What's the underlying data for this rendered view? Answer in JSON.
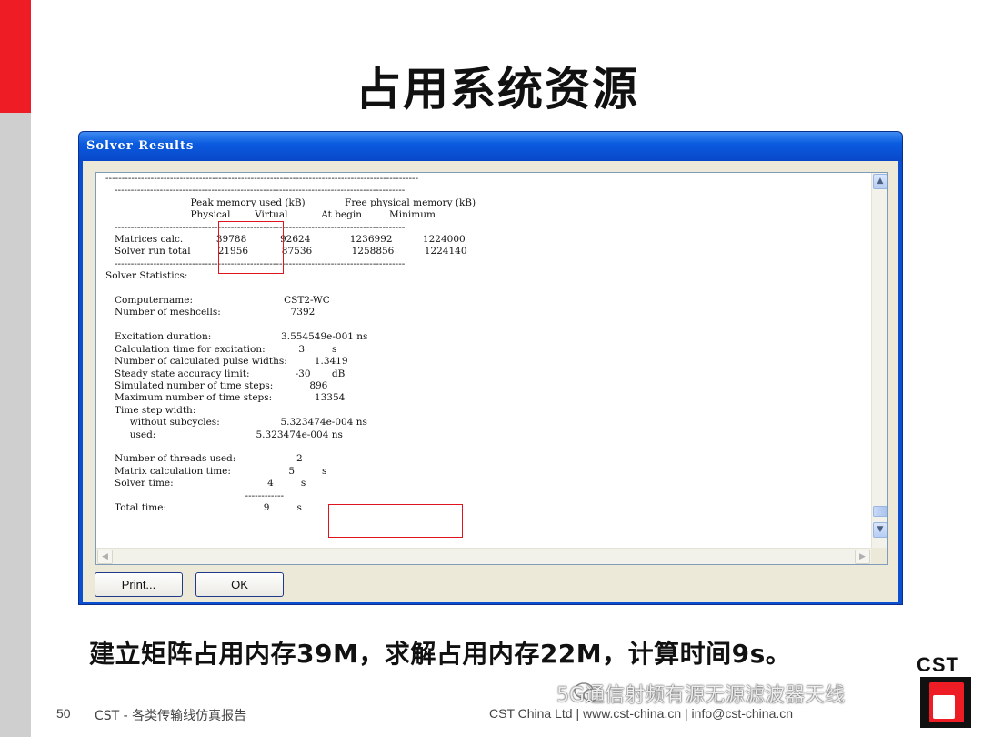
{
  "slide": {
    "title": "占用系统资源",
    "caption": "建立矩阵占用内存39M，求解占用内存22M，计算时间9s。",
    "page_number": "50",
    "footer_left": "CST - 各类传输线仿真报告",
    "footer_right": "CST China Ltd | www.cst-china.cn | info@cst-china.cn",
    "watermark": "5G通信射频有源无源滤波器天线",
    "logo_text": "CST",
    "accent_color": "#ee1c24"
  },
  "dialog": {
    "title": "Solver Results",
    "results_lines": [
      "-------------------------------------------------------------------------------------------------",
      "   ------------------------------------------------------------------------------------------",
      "                            Peak memory used (kB)             Free physical memory (kB)",
      "                            Physical        Virtual           At begin         Minimum",
      "   ------------------------------------------------------------------------------------------",
      "   Matrices calc.           39788           92624             1236992          1224000",
      "   Solver run total         21956           87536             1258856          1224140",
      "   ------------------------------------------------------------------------------------------",
      "Solver Statistics:",
      "",
      "   Computername:                              CST2-WC",
      "   Number of meshcells:                       7392",
      "",
      "   Excitation duration:                       3.554549e-001 ns",
      "   Calculation time for excitation:           3         s",
      "   Number of calculated pulse widths:         1.3419",
      "   Steady state accuracy limit:               -30       dB",
      "   Simulated number of time steps:            896",
      "   Maximum number of time steps:              13354",
      "   Time step width:",
      "        without subcycles:                    5.323474e-004 ns",
      "        used:                                 5.323474e-004 ns",
      "",
      "   Number of threads used:                    2",
      "   Matrix calculation time:                   5         s",
      "   Solver time:                               4         s",
      "                                              ------------",
      "   Total time:                                9         s"
    ],
    "print_button": "Print...",
    "ok_button": "OK"
  }
}
